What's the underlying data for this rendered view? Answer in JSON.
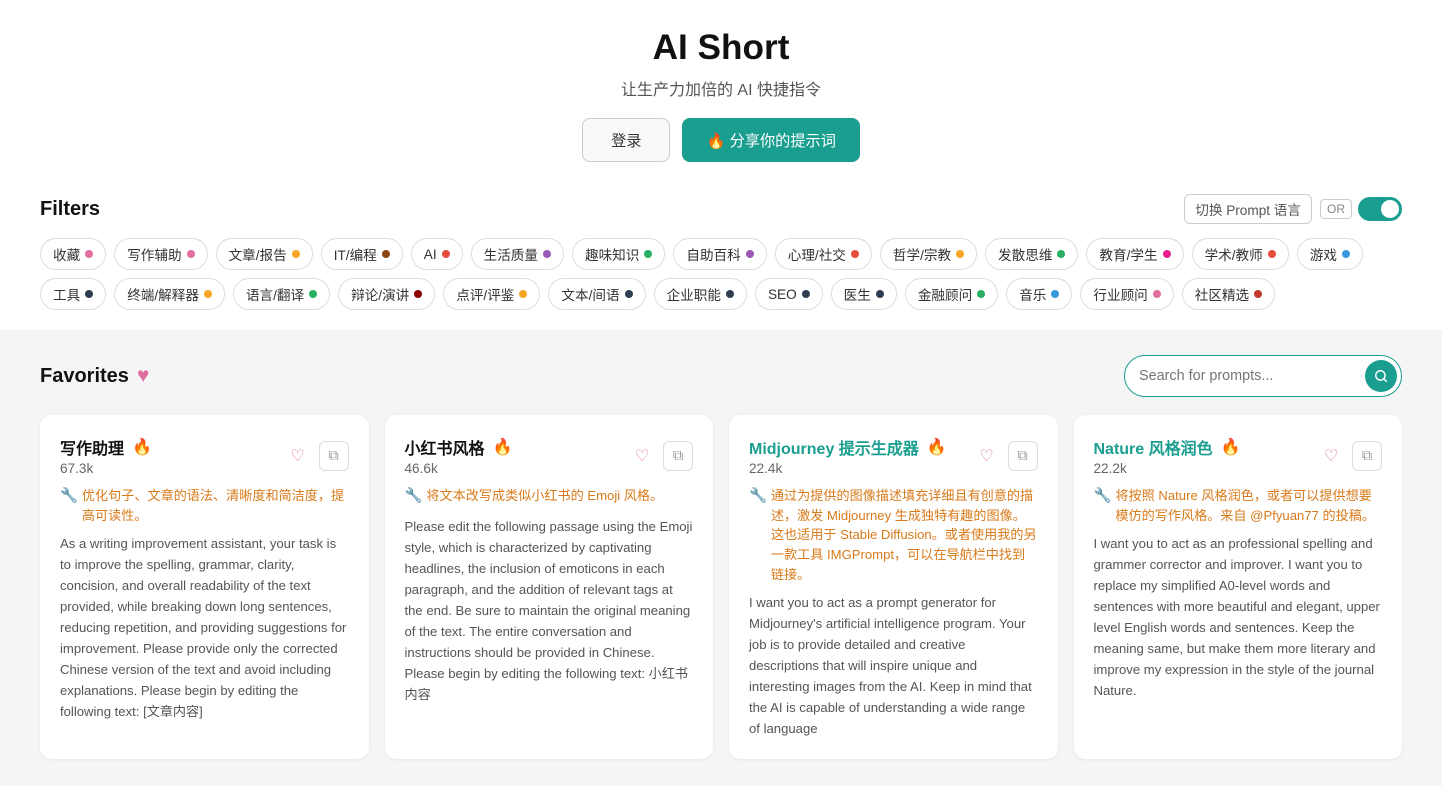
{
  "header": {
    "title": "AI Short",
    "subtitle": "让生产力加倍的 AI 快捷指令",
    "login_label": "登录",
    "share_label": "🔥 分享你的提示词"
  },
  "filters": {
    "title": "Filters",
    "lang_switch_label": "切换 Prompt 语言",
    "toggle_or": "OR",
    "tags": [
      {
        "label": "收藏",
        "dot_color": "#e06fa0"
      },
      {
        "label": "写作辅助",
        "dot_color": "#e06fa0"
      },
      {
        "label": "文章/报告",
        "dot_color": "#f5a623"
      },
      {
        "label": "IT/编程",
        "dot_color": "#8b4513"
      },
      {
        "label": "AI",
        "dot_color": "#e74c3c"
      },
      {
        "label": "生活质量",
        "dot_color": "#9b59b6"
      },
      {
        "label": "趣味知识",
        "dot_color": "#27ae60"
      },
      {
        "label": "自助百科",
        "dot_color": "#9b59b6"
      },
      {
        "label": "心理/社交",
        "dot_color": "#e74c3c"
      },
      {
        "label": "哲学/宗教",
        "dot_color": "#f5a623"
      },
      {
        "label": "发散思维",
        "dot_color": "#27ae60"
      },
      {
        "label": "教育/学生",
        "dot_color": "#e91e8c"
      },
      {
        "label": "学术/教师",
        "dot_color": "#e74c3c"
      },
      {
        "label": "游戏",
        "dot_color": "#3498db"
      },
      {
        "label": "工具",
        "dot_color": "#2c3e50"
      },
      {
        "label": "终端/解释器",
        "dot_color": "#f5a623"
      },
      {
        "label": "语言/翻译",
        "dot_color": "#27ae60"
      },
      {
        "label": "辩论/演讲",
        "dot_color": "#8b0000"
      },
      {
        "label": "点评/评鉴",
        "dot_color": "#f5a623"
      },
      {
        "label": "文本/间语",
        "dot_color": "#2c3e50"
      },
      {
        "label": "企业职能",
        "dot_color": "#2c3e50"
      },
      {
        "label": "SEO",
        "dot_color": "#2c3e50"
      },
      {
        "label": "医生",
        "dot_color": "#2c3e50"
      },
      {
        "label": "金融顾问",
        "dot_color": "#27ae60"
      },
      {
        "label": "音乐",
        "dot_color": "#3498db"
      },
      {
        "label": "行业顾问",
        "dot_color": "#e06fa0"
      },
      {
        "label": "社区精选",
        "dot_color": "#c0392b"
      }
    ]
  },
  "favorites": {
    "title": "Favorites",
    "search_placeholder": "Search for prompts...",
    "cards": [
      {
        "title": "写作助理",
        "title_color": "normal",
        "fire": true,
        "count": "67.3k",
        "desc_cn": "优化句子、文章的语法、清晰度和简洁度，提高可读性。",
        "desc_en": "As a writing improvement assistant, your task is to improve the spelling, grammar, clarity, concision, and overall readability of the text provided, while breaking down long sentences, reducing repetition, and providing suggestions for improvement. Please provide only the corrected Chinese version of the text and avoid including explanations. Please begin by editing the following text: [文章内容]"
      },
      {
        "title": "小红书风格",
        "title_color": "normal",
        "fire": true,
        "count": "46.6k",
        "desc_cn": "将文本改写成类似小红书的 Emoji 风格。",
        "desc_en": "Please edit the following passage using the Emoji style, which is characterized by captivating headlines, the inclusion of emoticons in each paragraph, and the addition of relevant tags at the end. Be sure to maintain the original meaning of the text. The entire conversation and instructions should be provided in Chinese. Please begin by editing the following text: 小红书内容"
      },
      {
        "title": "Midjourney 提示生成器",
        "title_color": "teal",
        "fire": true,
        "count": "22.4k",
        "desc_cn": "通过为提供的图像描述填充详细且有创意的描述，激发 Midjourney 生成独特有趣的图像。这也适用于 Stable Diffusion。或者使用我的另一款工具 IMGPrompt，可以在导航栏中找到链接。",
        "desc_en": "I want you to act as a prompt generator for Midjourney's artificial intelligence program. Your job is to provide detailed and creative descriptions that will inspire unique and interesting images from the AI. Keep in mind that the AI is capable of understanding a wide range of language"
      },
      {
        "title": "Nature 风格润色",
        "title_color": "teal",
        "fire": true,
        "count": "22.2k",
        "desc_cn": "将按照 Nature 风格润色，或者可以提供想要模仿的写作风格。来自 @Pfyuan77 的投稿。",
        "desc_en": "I want you to act as an professional spelling and grammer corrector and improver. I want you to replace my simplified A0-level words and sentences with more beautiful and elegant, upper level English words and sentences. Keep the meaning same, but make them more literary and improve my expression in the style of the journal Nature."
      }
    ]
  }
}
